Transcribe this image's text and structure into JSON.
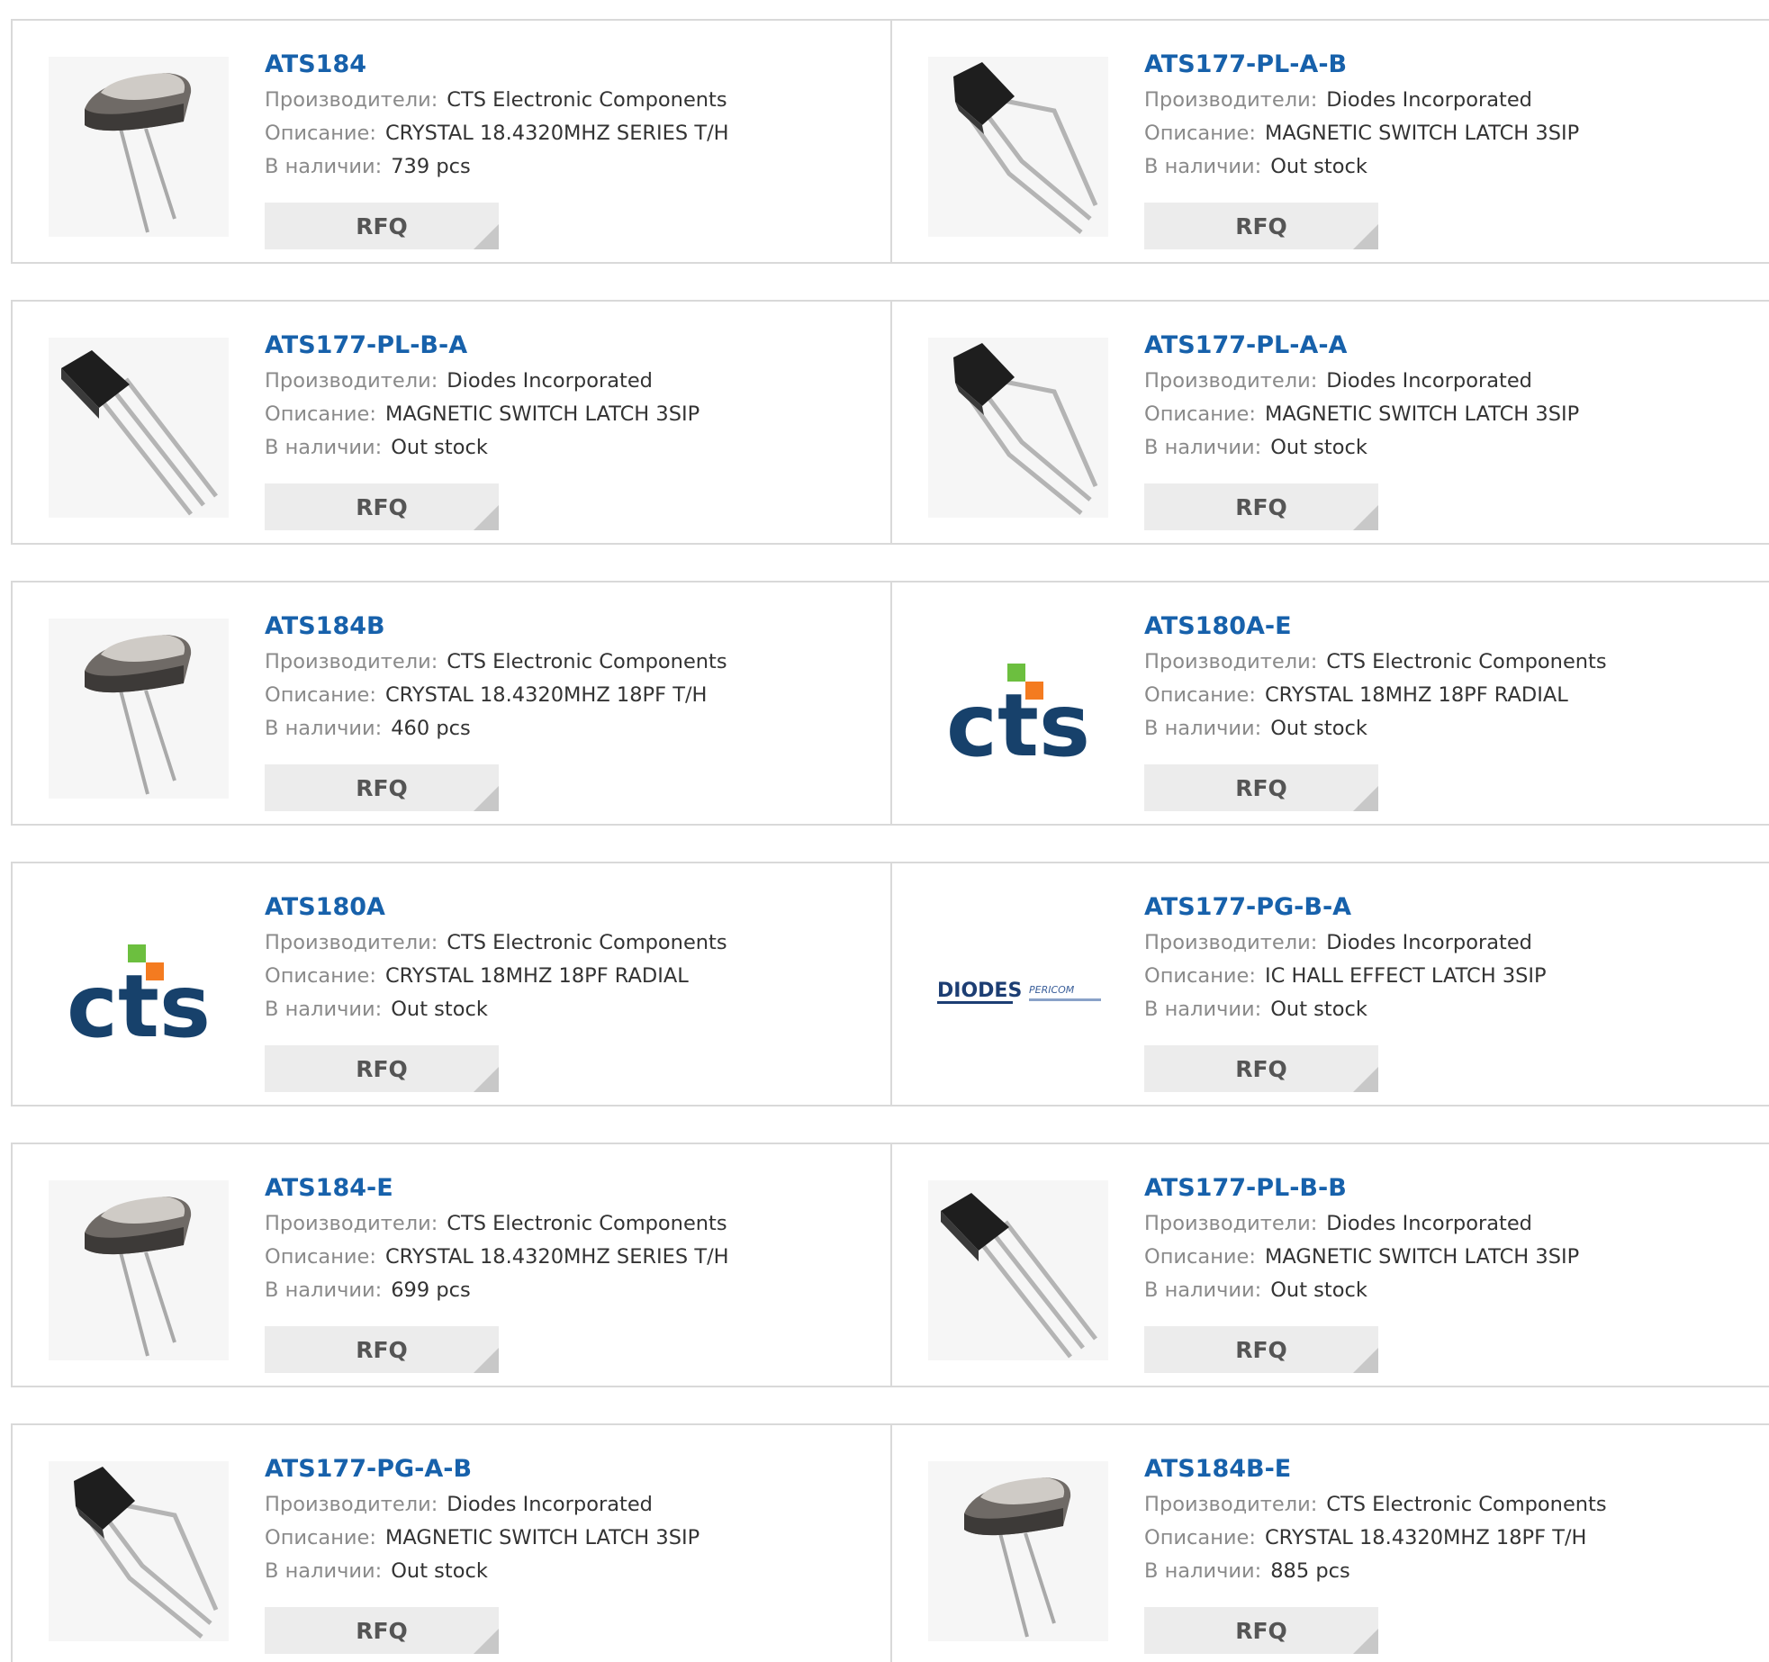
{
  "labels": {
    "manufacturer": "Производители:",
    "description": "Описание:",
    "stock": "В наличии:",
    "rfq": "RFQ"
  },
  "colors": {
    "title": "#1761ab",
    "label": "#8a8a8a",
    "value": "#333333",
    "button_bg": "#ececec"
  },
  "products": [
    {
      "part": "ATS184",
      "manufacturer": "CTS Electronic Components",
      "description": "CRYSTAL 18.4320MHZ SERIES T/H",
      "stock": "739 pcs",
      "image": "crystal-hc49-icon"
    },
    {
      "part": "ATS177-PL-A-B",
      "manufacturer": "Diodes Incorporated",
      "description": "MAGNETIC SWITCH LATCH 3SIP",
      "stock": "Out stock",
      "image": "hall-sensor-bent-icon"
    },
    {
      "part": "ATS177-PL-B-A",
      "manufacturer": "Diodes Incorporated",
      "description": "MAGNETIC SWITCH LATCH 3SIP",
      "stock": "Out stock",
      "image": "hall-sensor-straight-icon"
    },
    {
      "part": "ATS177-PL-A-A",
      "manufacturer": "Diodes Incorporated",
      "description": "MAGNETIC SWITCH LATCH 3SIP",
      "stock": "Out stock",
      "image": "hall-sensor-bent-icon"
    },
    {
      "part": "ATS184B",
      "manufacturer": "CTS Electronic Components",
      "description": "CRYSTAL 18.4320MHZ 18PF T/H",
      "stock": "460 pcs",
      "image": "crystal-hc49-icon"
    },
    {
      "part": "ATS180A-E",
      "manufacturer": "CTS Electronic Components",
      "description": "CRYSTAL 18MHZ 18PF RADIAL",
      "stock": "Out stock",
      "image": "cts-logo"
    },
    {
      "part": "ATS180A",
      "manufacturer": "CTS Electronic Components",
      "description": "CRYSTAL 18MHZ 18PF RADIAL",
      "stock": "Out stock",
      "image": "cts-logo"
    },
    {
      "part": "ATS177-PG-B-A",
      "manufacturer": "Diodes Incorporated",
      "description": "IC HALL EFFECT LATCH 3SIP",
      "stock": "Out stock",
      "image": "diodes-pericom-logo"
    },
    {
      "part": "ATS184-E",
      "manufacturer": "CTS Electronic Components",
      "description": "CRYSTAL 18.4320MHZ SERIES T/H",
      "stock": "699 pcs",
      "image": "crystal-hc49-icon"
    },
    {
      "part": "ATS177-PL-B-B",
      "manufacturer": "Diodes Incorporated",
      "description": "MAGNETIC SWITCH LATCH 3SIP",
      "stock": "Out stock",
      "image": "hall-sensor-straight-icon"
    },
    {
      "part": "ATS177-PG-A-B",
      "manufacturer": "Diodes Incorporated",
      "description": "MAGNETIC SWITCH LATCH 3SIP",
      "stock": "Out stock",
      "image": "hall-sensor-bent-icon"
    },
    {
      "part": "ATS184B-E",
      "manufacturer": "CTS Electronic Components",
      "description": "CRYSTAL 18.4320MHZ 18PF T/H",
      "stock": "885 pcs",
      "image": "crystal-hc49-icon"
    }
  ]
}
